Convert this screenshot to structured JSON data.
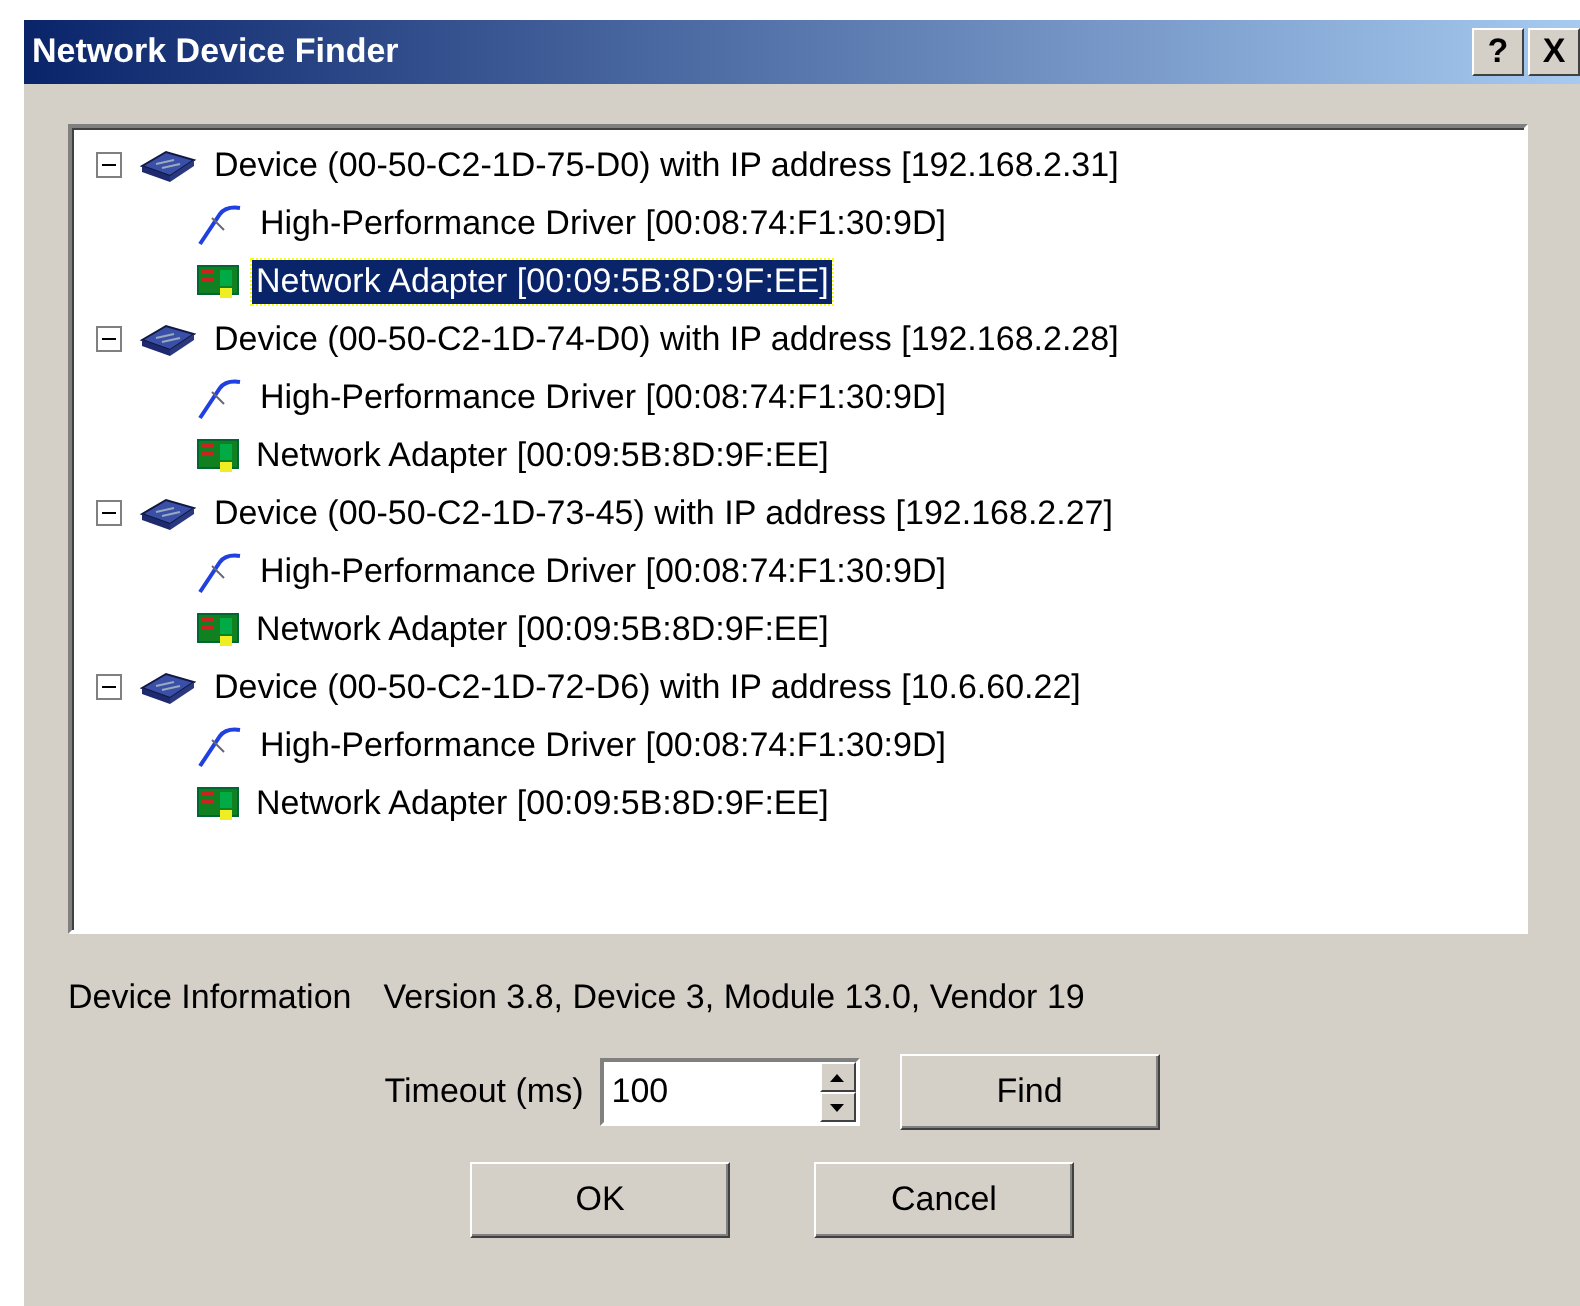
{
  "window": {
    "title": "Network Device Finder",
    "help_button": "?",
    "close_button": "X"
  },
  "tree": [
    {
      "kind": "device",
      "label": "Device (00-50-C2-1D-75-D0) with IP address [192.168.2.31]",
      "expanded": true,
      "selected": false,
      "children": [
        {
          "kind": "driver",
          "label": "High-Performance Driver [00:08:74:F1:30:9D]",
          "selected": false
        },
        {
          "kind": "adapter",
          "label": "Network Adapter [00:09:5B:8D:9F:EE]",
          "selected": true
        }
      ]
    },
    {
      "kind": "device",
      "label": "Device (00-50-C2-1D-74-D0) with IP address [192.168.2.28]",
      "expanded": true,
      "selected": false,
      "children": [
        {
          "kind": "driver",
          "label": "High-Performance Driver [00:08:74:F1:30:9D]",
          "selected": false
        },
        {
          "kind": "adapter",
          "label": "Network Adapter [00:09:5B:8D:9F:EE]",
          "selected": false
        }
      ]
    },
    {
      "kind": "device",
      "label": "Device (00-50-C2-1D-73-45) with IP address [192.168.2.27]",
      "expanded": true,
      "selected": false,
      "children": [
        {
          "kind": "driver",
          "label": "High-Performance Driver [00:08:74:F1:30:9D]",
          "selected": false
        },
        {
          "kind": "adapter",
          "label": "Network Adapter [00:09:5B:8D:9F:EE]",
          "selected": false
        }
      ]
    },
    {
      "kind": "device",
      "label": "Device (00-50-C2-1D-72-D6) with IP address [10.6.60.22]",
      "expanded": true,
      "selected": false,
      "children": [
        {
          "kind": "driver",
          "label": "High-Performance Driver [00:08:74:F1:30:9D]",
          "selected": false
        },
        {
          "kind": "adapter",
          "label": "Network Adapter [00:09:5B:8D:9F:EE]",
          "selected": false
        }
      ]
    }
  ],
  "device_information": {
    "label": "Device Information",
    "value": "Version 3.8, Device 3, Module 13.0, Vendor 19"
  },
  "timeout": {
    "label": "Timeout (ms)",
    "value": "100"
  },
  "buttons": {
    "find": "Find",
    "ok": "OK",
    "cancel": "Cancel"
  }
}
